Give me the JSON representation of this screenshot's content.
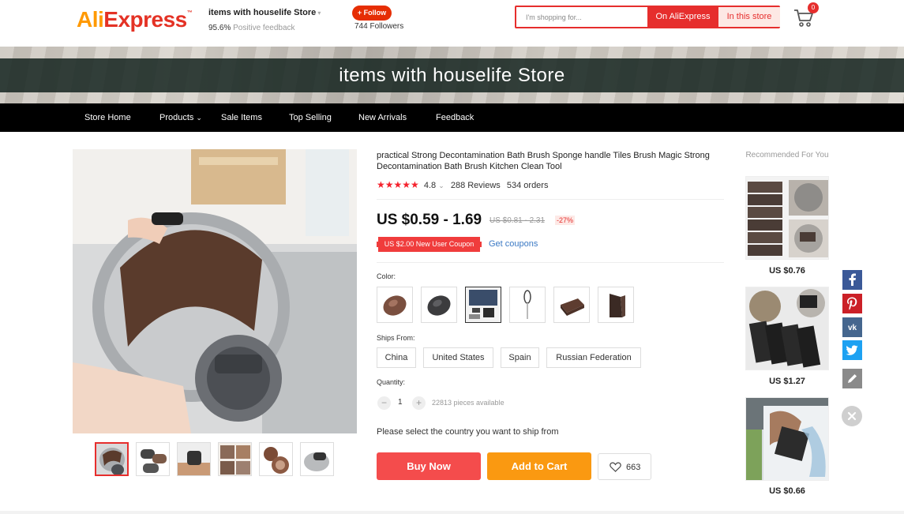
{
  "header": {
    "logo_ali": "Ali",
    "logo_express": "Express",
    "logo_tm": "™",
    "store_name": "items with houselife Store",
    "feedback_value": "95.6%",
    "feedback_label": "Positive feedback",
    "follow_label": "+ Follow",
    "followers": "744 Followers",
    "search_placeholder": "I'm shopping for...",
    "search_on_aliexpress": "On AliExpress",
    "search_in_store": "In this store",
    "cart_count": "0"
  },
  "banner": {
    "title": "items with houselife Store"
  },
  "nav": {
    "items": [
      "Store Home",
      "Products",
      "Sale Items",
      "Top Selling",
      "New Arrivals",
      "Feedback"
    ]
  },
  "product": {
    "title": "practical Strong Decontamination Bath Brush Sponge handle Tiles Brush Magic Strong Decontamination Bath Brush Kitchen Clean Tool",
    "rating": "4.8",
    "stars": "★★★★★",
    "reviews": "288 Reviews",
    "orders": "534 orders",
    "price": "US $0.59 - 1.69",
    "old_price": "US $0.81 - 2.31",
    "discount": "-27%",
    "coupon": "US $2.00 New User Coupon",
    "get_coupons": "Get coupons",
    "color_label": "Color:",
    "ships_from_label": "Ships From:",
    "ships_from": [
      "China",
      "United States",
      "Spain",
      "Russian Federation"
    ],
    "quantity_label": "Quantity:",
    "quantity": "1",
    "minus": "−",
    "plus": "+",
    "pieces_available": "22813 pieces available",
    "ship_note": "Please select the country you want to ship from",
    "buy_now": "Buy Now",
    "add_to_cart": "Add to Cart",
    "wishlist_count": "663"
  },
  "recommended": {
    "title": "Recommended For You",
    "items": [
      {
        "price": "US $0.76"
      },
      {
        "price": "US $1.27"
      },
      {
        "price": "US $0.66"
      }
    ]
  },
  "colors": {
    "accent": "#e62e2d",
    "buy": "#f44c4c",
    "cart": "#fa9911",
    "nav": "#000000",
    "link": "#3b79c4"
  },
  "share_icons": [
    "facebook-icon",
    "pinterest-icon",
    "vk-icon",
    "twitter-icon",
    "pencil-icon",
    "close-icon"
  ]
}
